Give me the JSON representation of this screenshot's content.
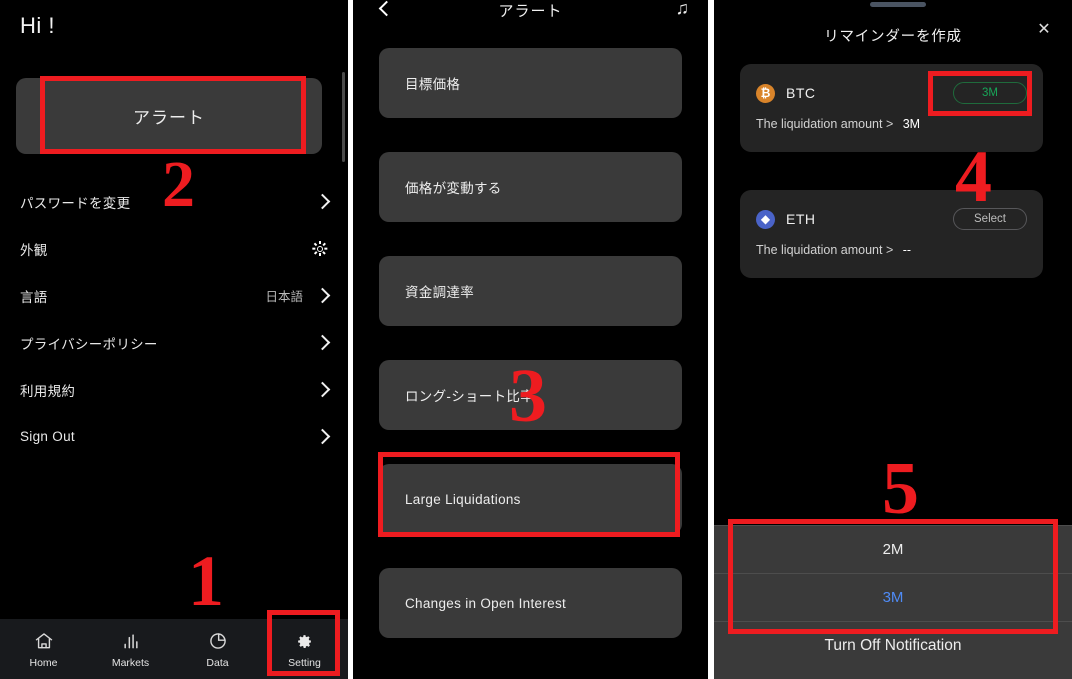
{
  "panel1": {
    "greeting": "Hi !",
    "alert_button": "アラート",
    "settings_rows": [
      {
        "label": "パスワードを変更",
        "value": "",
        "accessory": "chevron"
      },
      {
        "label": "外観",
        "value": "",
        "accessory": "sun"
      },
      {
        "label": "言語",
        "value": "日本語",
        "accessory": "chevron"
      },
      {
        "label": "プライバシーポリシー",
        "value": "",
        "accessory": "chevron"
      },
      {
        "label": "利用規約",
        "value": "",
        "accessory": "chevron"
      },
      {
        "label": "Sign Out",
        "value": "",
        "accessory": "chevron"
      }
    ],
    "tabbar": [
      {
        "label": "Home",
        "icon": "home-icon",
        "active": false
      },
      {
        "label": "Markets",
        "icon": "bar-chart-icon",
        "active": false
      },
      {
        "label": "Data",
        "icon": "pie-chart-icon",
        "active": false
      },
      {
        "label": "Setting",
        "icon": "gear-icon",
        "active": true
      }
    ]
  },
  "panel2": {
    "title": "アラート",
    "back_icon": "chevron-left-icon",
    "sound_icon": "music-note-icon",
    "items": [
      {
        "label": "目標価格"
      },
      {
        "label": "価格が変動する"
      },
      {
        "label": "資金調達率"
      },
      {
        "label": "ロング-ショート比率"
      },
      {
        "label": "Large Liquidations"
      },
      {
        "label": "Changes in Open Interest"
      }
    ]
  },
  "panel3": {
    "title": "リマインダーを作成",
    "close_icon": "close-icon",
    "handle_icon": "drag-handle-icon",
    "coins": [
      {
        "symbol": "BTC",
        "logo_glyph": "₿",
        "logo_color": "#d9842a",
        "button_label": "3M",
        "button_style": "green",
        "description": "The liquidation amount >",
        "value": "3M"
      },
      {
        "symbol": "ETH",
        "logo_glyph": "◆",
        "logo_color": "#4a63c8",
        "button_label": "Select",
        "button_style": "plain",
        "description": "The liquidation amount >",
        "value": "--"
      }
    ],
    "picker": {
      "options": [
        {
          "label": "2M",
          "selected": false
        },
        {
          "label": "3M",
          "selected": true
        }
      ],
      "action_label": "Turn Off Notification",
      "selected_color": "#4f8bf5"
    }
  },
  "annotations": {
    "color": "#ee1c20",
    "steps": [
      "1",
      "2",
      "3",
      "4",
      "5"
    ]
  }
}
